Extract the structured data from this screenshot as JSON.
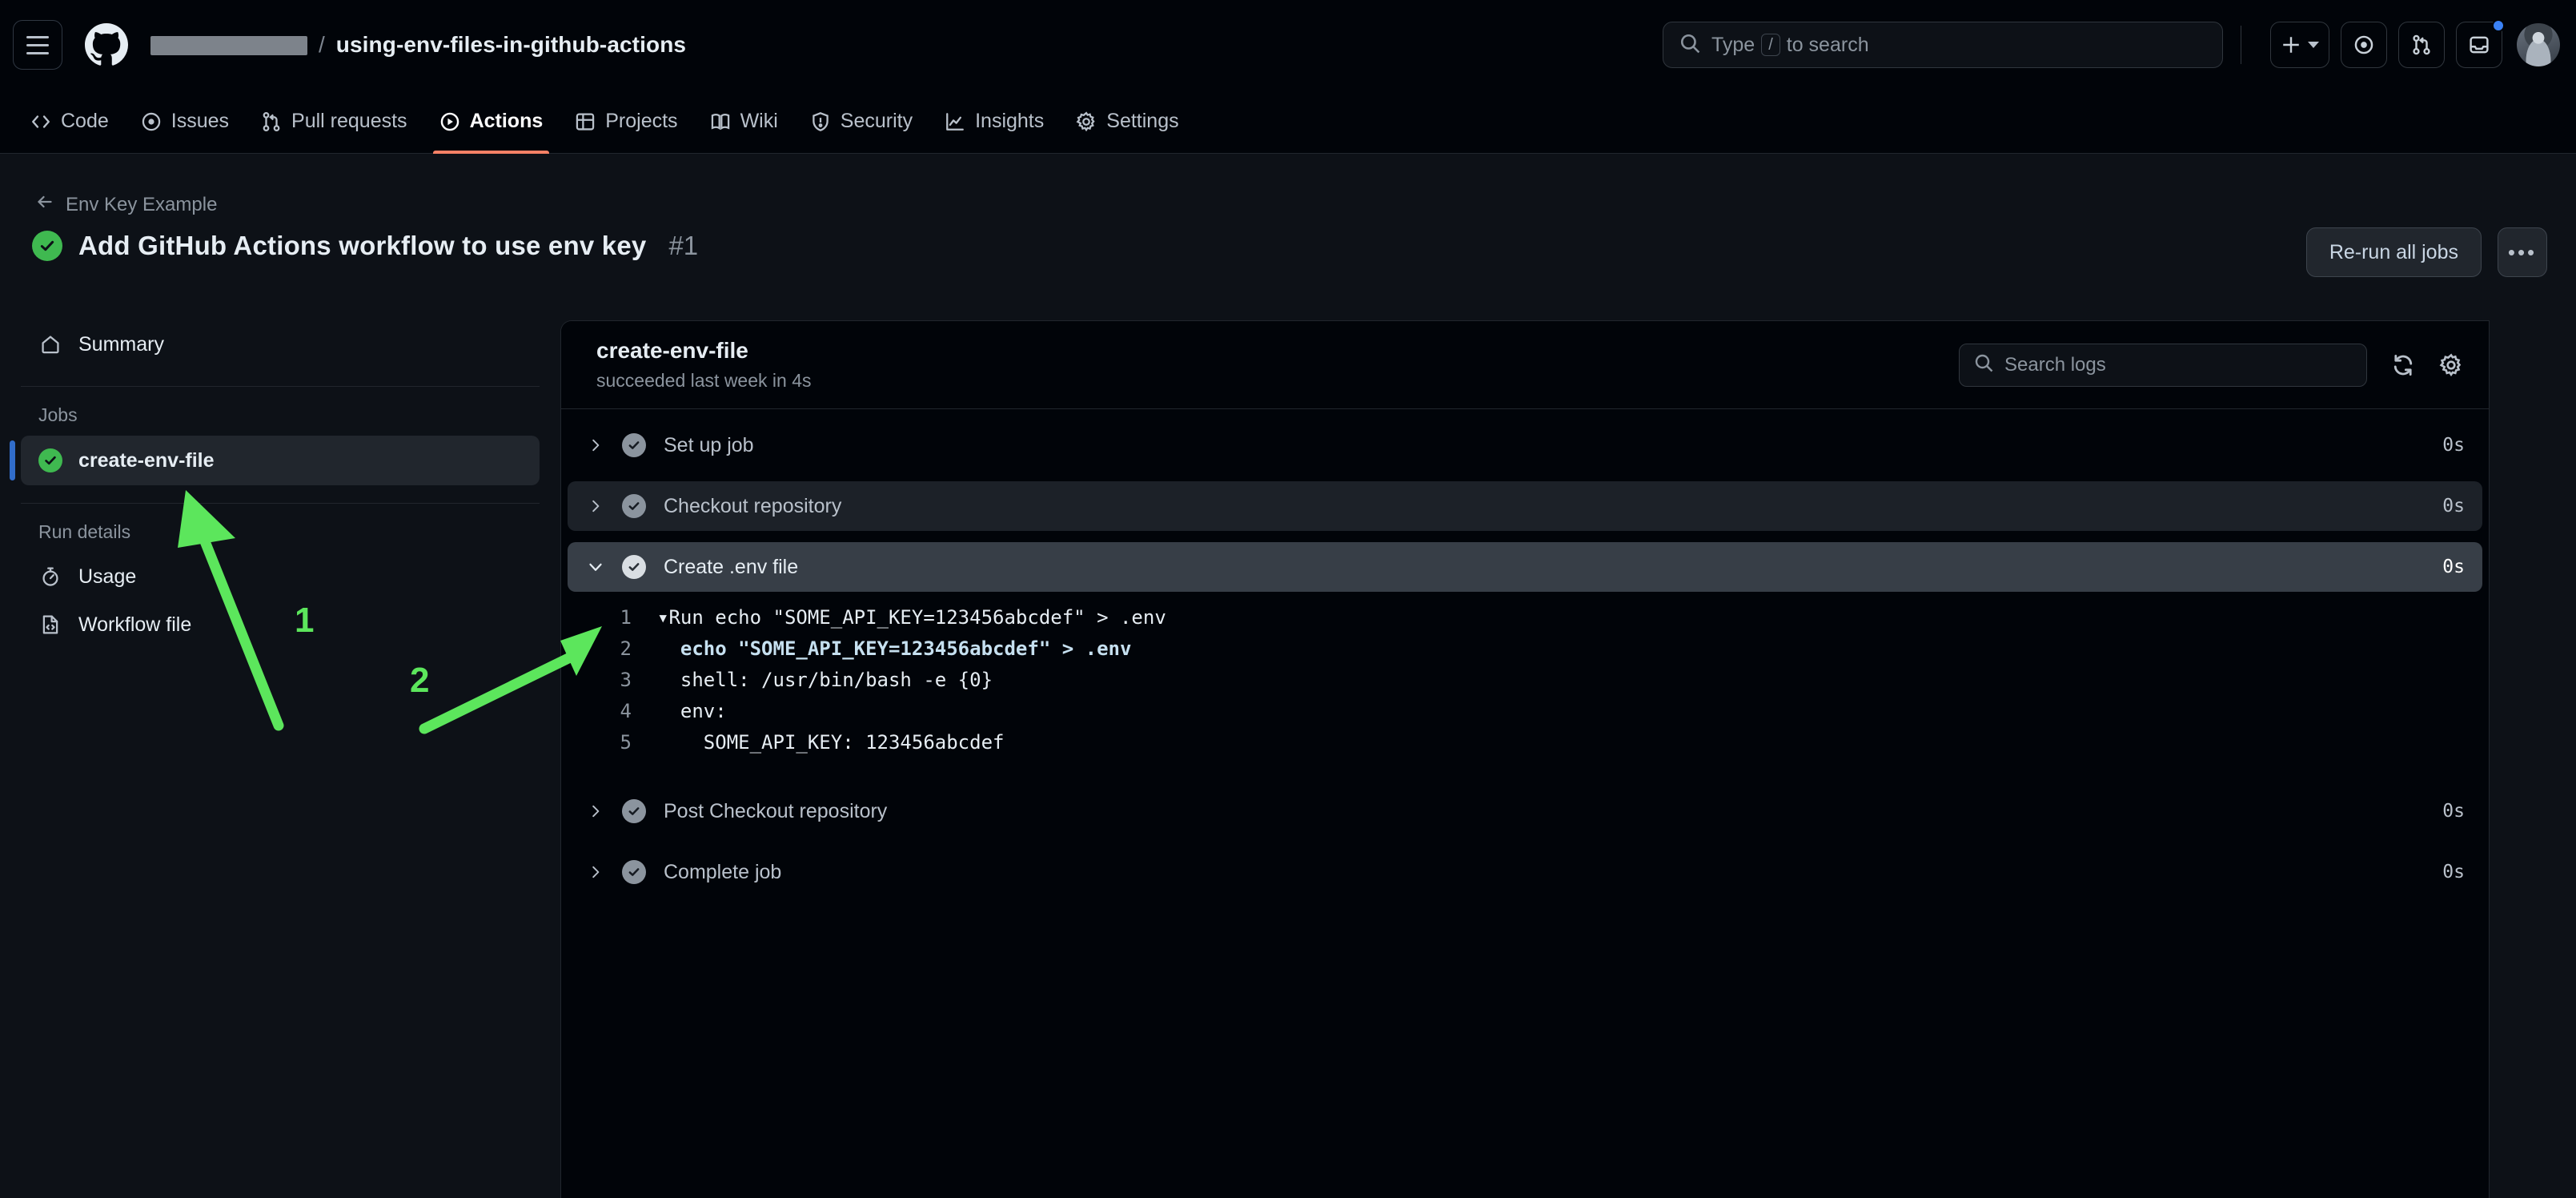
{
  "header": {
    "hamburger_icon": "hamburger-menu-icon",
    "logo_icon": "github-logo-icon",
    "owner_redacted": "",
    "separator": "/",
    "repo_name": "using-env-files-in-github-actions",
    "search": {
      "placeholder": "Type",
      "key_hint": "/",
      "placeholder_tail": "to search",
      "icon": "search-icon"
    },
    "create_new": {
      "icon": "plus-icon",
      "caret": "chevron-down-icon"
    },
    "issues_icon": "issues-icon",
    "pull_requests_icon": "pull-request-icon",
    "inbox_icon": "inbox-icon",
    "has_notification": true,
    "avatar": "user-avatar"
  },
  "repo_nav": {
    "tabs": [
      {
        "label": "Code",
        "icon": "code-icon",
        "active": false
      },
      {
        "label": "Issues",
        "icon": "issues-icon",
        "active": false
      },
      {
        "label": "Pull requests",
        "icon": "pull-request-icon",
        "active": false
      },
      {
        "label": "Actions",
        "icon": "play-circle-icon",
        "active": true
      },
      {
        "label": "Projects",
        "icon": "table-icon",
        "active": false
      },
      {
        "label": "Wiki",
        "icon": "book-icon",
        "active": false
      },
      {
        "label": "Security",
        "icon": "shield-icon",
        "active": false
      },
      {
        "label": "Insights",
        "icon": "graph-icon",
        "active": false
      },
      {
        "label": "Settings",
        "icon": "gear-icon",
        "active": false
      }
    ]
  },
  "run": {
    "back_label": "Env Key Example",
    "back_icon": "arrow-left-icon",
    "status_icon": "check-circle-success-icon",
    "title": "Add GitHub Actions workflow to use env key",
    "number": "#1",
    "rerun_label": "Re-run all jobs",
    "kebab_label": "•••"
  },
  "sidebar": {
    "summary": {
      "label": "Summary",
      "icon": "home-icon"
    },
    "jobs_heading": "Jobs",
    "jobs": [
      {
        "label": "create-env-file",
        "status_icon": "check-circle-success-icon",
        "selected": true
      }
    ],
    "run_details_heading": "Run details",
    "details": [
      {
        "label": "Usage",
        "icon": "stopwatch-icon"
      },
      {
        "label": "Workflow file",
        "icon": "workflow-file-icon"
      }
    ]
  },
  "log_panel": {
    "job_title": "create-env-file",
    "job_subtitle": "succeeded last week in 4s",
    "search": {
      "placeholder": "Search logs",
      "icon": "search-icon"
    },
    "refresh_icon": "sync-refresh-icon",
    "settings_icon": "gear-icon",
    "steps": [
      {
        "name": "Set up job",
        "duration": "0s",
        "expanded": false,
        "shade": "plain",
        "status_icon": "check-circle-icon",
        "chevron": "chevron-right-icon"
      },
      {
        "name": "Checkout repository",
        "duration": "0s",
        "expanded": false,
        "shade": "alt",
        "status_icon": "check-circle-icon",
        "chevron": "chevron-right-icon"
      },
      {
        "name": "Create .env file",
        "duration": "0s",
        "expanded": true,
        "shade": "expanded",
        "status_icon": "check-circle-icon",
        "chevron": "chevron-down-icon"
      },
      {
        "name": "Post Checkout repository",
        "duration": "0s",
        "expanded": false,
        "shade": "plain",
        "status_icon": "check-circle-icon",
        "chevron": "chevron-right-icon"
      },
      {
        "name": "Complete job",
        "duration": "0s",
        "expanded": false,
        "shade": "plain",
        "status_icon": "check-circle-icon",
        "chevron": "chevron-right-icon"
      }
    ],
    "log_lines": [
      {
        "num": "1",
        "text": "▾Run echo \"SOME_API_KEY=123456abcdef\" > .env",
        "style": "plain"
      },
      {
        "num": "2",
        "text": "  echo \"SOME_API_KEY=123456abcdef\" > .env",
        "style": "cmd"
      },
      {
        "num": "3",
        "text": "  shell: /usr/bin/bash -e {0}",
        "style": "plain"
      },
      {
        "num": "4",
        "text": "  env:",
        "style": "plain"
      },
      {
        "num": "5",
        "text": "    SOME_API_KEY: 123456abcdef",
        "style": "plain"
      }
    ]
  },
  "annotations": {
    "color": "#5ce65c",
    "markers": [
      {
        "label": "1",
        "target": "sidebar-job-create-env-file"
      },
      {
        "label": "2",
        "target": "step-create-env-file-chevron"
      }
    ]
  }
}
